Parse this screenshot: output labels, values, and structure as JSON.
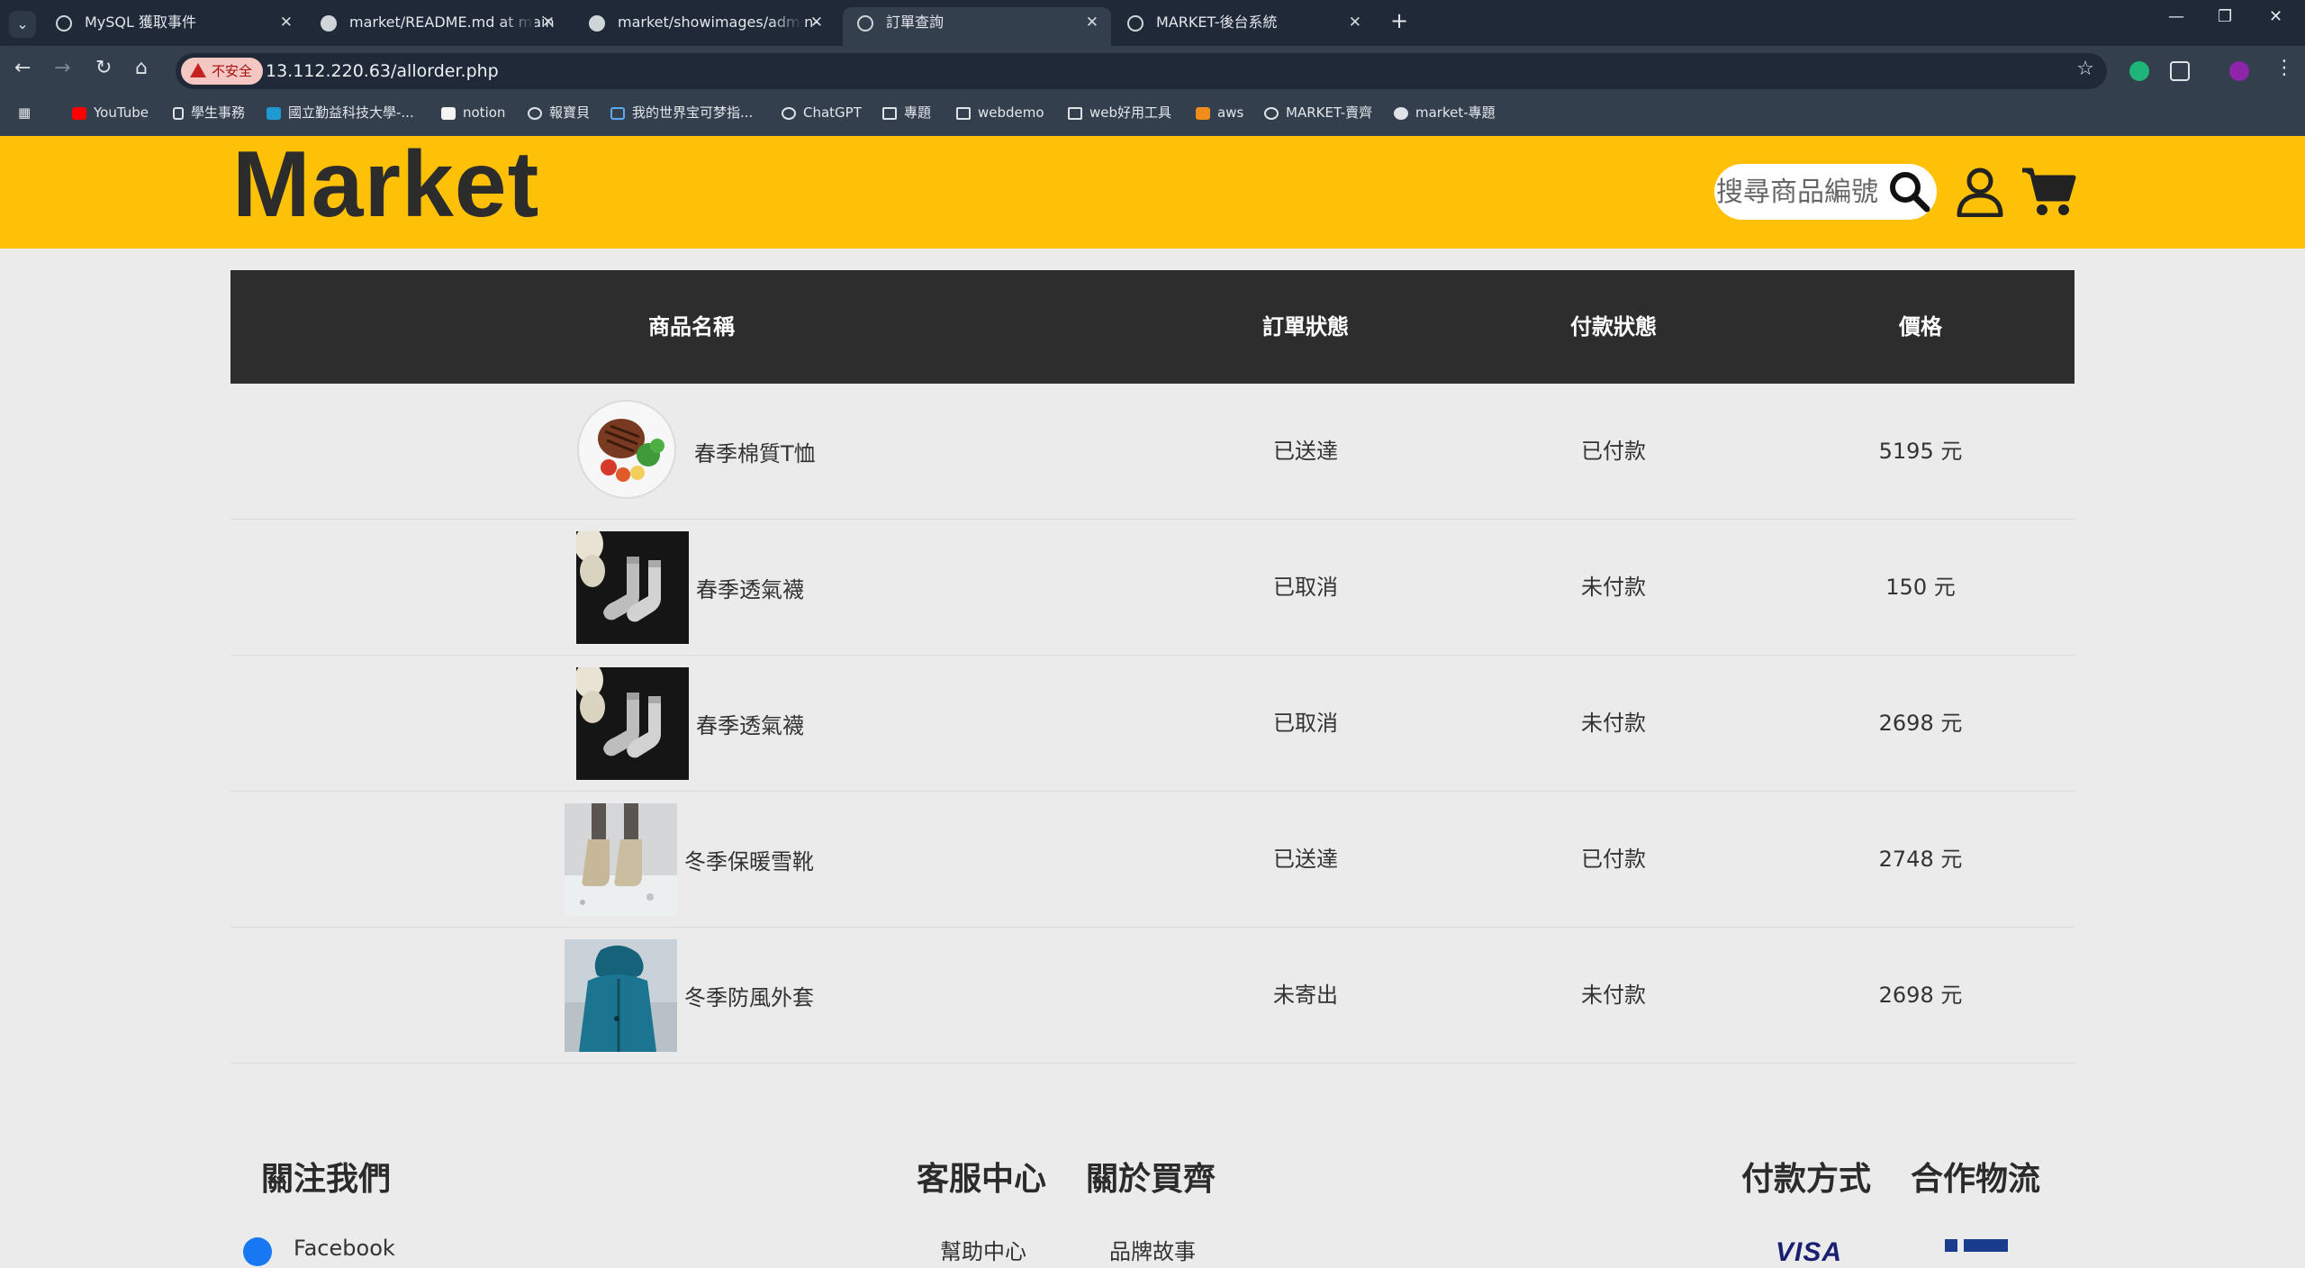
{
  "browser": {
    "tabs": [
      {
        "title": "MySQL 獲取事件",
        "active": false
      },
      {
        "title": "market/README.md at main",
        "active": false
      },
      {
        "title": "market/showimages/admin-",
        "active": false
      },
      {
        "title": "訂單查詢",
        "active": true
      },
      {
        "title": "MARKET-後台系統",
        "active": false
      }
    ],
    "security_chip": "不安全",
    "url": "13.112.220.63/allorder.php",
    "bookmarks": [
      "YouTube",
      "學生事務",
      "國立勤益科技大學-...",
      "notion",
      "報寶貝",
      "我的世界宝可梦指...",
      "ChatGPT",
      "專題",
      "webdemo",
      "web好用工具",
      "aws",
      "MARKET-賣齊",
      "market-專題"
    ]
  },
  "site": {
    "logo": "Market",
    "search_placeholder": "搜尋商品編號",
    "accent_color": "#ffc107"
  },
  "orders": {
    "headers": {
      "product": "商品名稱",
      "order_status": "訂單狀態",
      "payment_status": "付款狀態",
      "price": "價格"
    },
    "rows": [
      {
        "product": "春季棉質T恤",
        "image": "steak-plate",
        "order_status": "已送達",
        "payment_status": "已付款",
        "price": "5195 元"
      },
      {
        "product": "春季透氣襪",
        "image": "socks",
        "order_status": "已取消",
        "payment_status": "未付款",
        "price": "150 元"
      },
      {
        "product": "春季透氣襪",
        "image": "socks",
        "order_status": "已取消",
        "payment_status": "未付款",
        "price": "2698 元"
      },
      {
        "product": "冬季保暖雪靴",
        "image": "snow-boots",
        "order_status": "已送達",
        "payment_status": "已付款",
        "price": "2748 元"
      },
      {
        "product": "冬季防風外套",
        "image": "teal-jacket",
        "order_status": "未寄出",
        "payment_status": "未付款",
        "price": "2698 元"
      }
    ]
  },
  "footer": {
    "follow_us": "關注我們",
    "customer_service": "客服中心",
    "about": "關於買齊",
    "payment": "付款方式",
    "logistics": "合作物流",
    "links": {
      "facebook": "Facebook",
      "help_center": "幫助中心",
      "brand_story": "品牌故事"
    }
  }
}
